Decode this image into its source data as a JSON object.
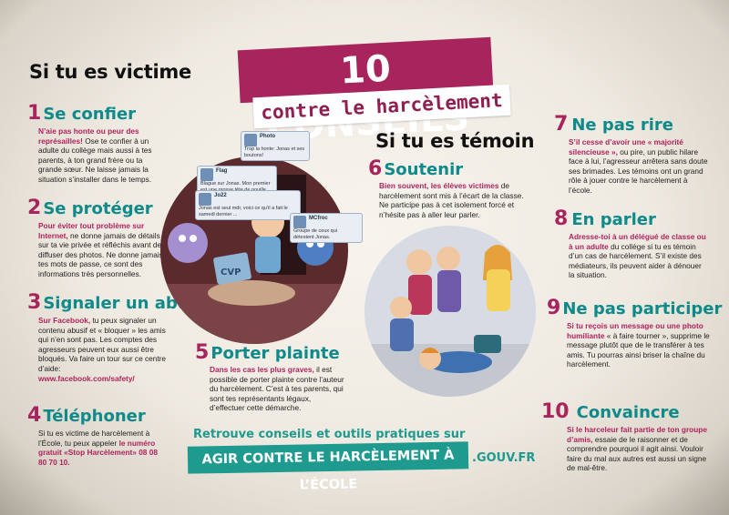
{
  "title": {
    "line1": "10 CONSEILS",
    "line2": "contre le harcèlement"
  },
  "victim": {
    "heading": "Si tu es victime",
    "tips": [
      {
        "num": "1",
        "title": "Se confier",
        "lead": "N’aie pas honte ou peur des représailles!",
        "text": " Ose te confier à un adulte du collège mais aussi à tes parents, à ton grand frère ou ta grande sœur. Ne laisse jamais la situation s’installer dans le temps."
      },
      {
        "num": "2",
        "title": "Se protéger",
        "lead": "Pour éviter tout problème sur Internet,",
        "text": " ne donne jamais de détails sur ta vie privée et réfléchis avant de diffuser des photos. Ne donne jamais tes mots de passe, ce sont des informations très personnelles."
      },
      {
        "num": "3",
        "title": "Signaler un abus",
        "lead": "Sur Facebook,",
        "text": " tu peux signaler un contenu abusif et « bloquer » les amis qui n’en sont pas. Les comptes des agresseurs peuvent eux aussi être bloqués. Va faire un tour sur ce centre d’aide:",
        "link": "www.facebook.com/safety/"
      },
      {
        "num": "4",
        "title": "Téléphoner",
        "text": "Si tu es victime de harcèlement à l’École, tu peux appeler ",
        "lead": "le numéro gratuit «Stop Harcèlement» 08 08 80 70 10."
      }
    ]
  },
  "witness": {
    "heading": "Si tu es témoin",
    "tips": [
      {
        "num": "5",
        "title": "Porter plainte",
        "lead": "Dans les cas les plus graves,",
        "text": " il est possible de porter plainte contre l’auteur du harcèlement. C’est à tes parents, qui sont tes représentants légaux, d’effectuer cette démarche."
      },
      {
        "num": "6",
        "title": "Soutenir",
        "lead": "Bien souvent, les élèves victimes",
        "text": " de harcèlement sont mis à l’écart de la classe. Ne participe pas à cet isolement forcé et n’hésite pas à aller leur parler."
      },
      {
        "num": "7",
        "title": "Ne pas rire",
        "lead": "S’il cesse d’avoir une « majorité silencieuse »,",
        "text": " ou pire, un public hilare face à lui, l’agresseur arrêtera sans doute ses brimades. Les témoins ont un grand rôle à jouer contre le harcèlement à l’école."
      },
      {
        "num": "8",
        "title": "En parler",
        "lead": "Adresse-toi à un délégué de classe ou à un adulte",
        "text": " du collège si tu es témoin d’un cas de harcèlement. S’il existe des médiateurs, ils peuvent aider à dénouer la situation."
      },
      {
        "num": "9",
        "title": "Ne pas participer",
        "lead": "Si tu reçois un message ou une photo humiliante",
        "text": " « à faire tourner », supprime le message plutôt que de le transférer à tes amis. Tu pourras ainsi briser la chaîne du harcèlement."
      },
      {
        "num": "10",
        "title": "Convaincre",
        "lead": "Si le harceleur fait partie de ton groupe d’amis,",
        "text": " essaie de le raisonner et de comprendre pourquoi il agit ainsi. Vouloir faire du mal aux autres est aussi un signe de mal-être."
      }
    ]
  },
  "chat": [
    {
      "name": "Photo",
      "msg": "Trop la honte: Jonas et ses boutons!"
    },
    {
      "name": "Flag",
      "msg": "Blague sur Jonas. Mon premier est une grosse tête de nouille..."
    },
    {
      "name": "Jo22",
      "msg": "Jonas est seul mdr, voici ce qu’il a fait le samedi dernier ..."
    },
    {
      "name": "MCfroc",
      "msg": "Groupe de ceux qui détestent Jonas."
    }
  ],
  "laptop_label": "CVP",
  "footer": {
    "line": "Retrouve conseils et outils pratiques sur",
    "site": "AGIR CONTRE LE HARCÈLEMENT À L’ÉCOLE",
    "tld": ".GOUV.FR"
  },
  "colors": {
    "magenta": "#a8245d",
    "teal": "#1f9a8e"
  }
}
